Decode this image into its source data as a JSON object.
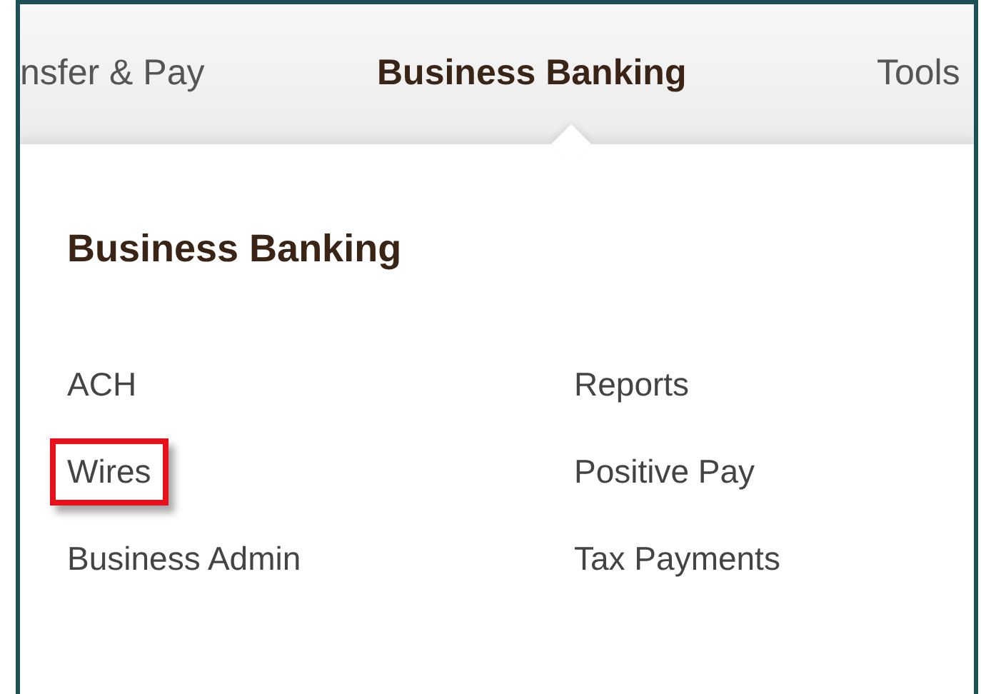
{
  "nav": [
    {
      "label": "nsfer & Pay",
      "selected": false
    },
    {
      "label": "Business Banking",
      "selected": true
    },
    {
      "label": "Tools",
      "selected": false
    }
  ],
  "menu": {
    "title": "Business Banking",
    "columns": [
      [
        {
          "label": "ACH",
          "highlighted": false
        },
        {
          "label": "Wires",
          "highlighted": true
        },
        {
          "label": "Business Admin",
          "highlighted": false
        }
      ],
      [
        {
          "label": "Reports",
          "highlighted": false
        },
        {
          "label": "Positive Pay",
          "highlighted": false
        },
        {
          "label": "Tax Payments",
          "highlighted": false
        }
      ]
    ]
  }
}
